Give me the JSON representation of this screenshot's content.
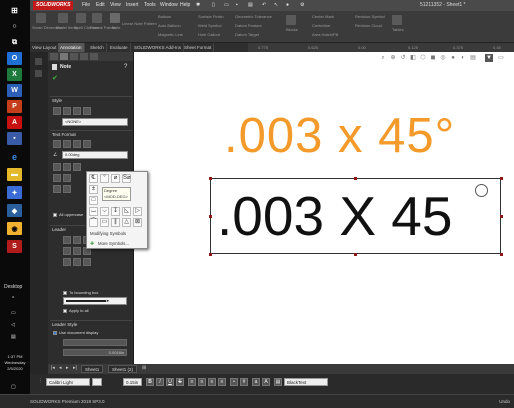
{
  "taskbar": {
    "desktop_label": "Desktop",
    "time": "1:37 PM",
    "day": "Wednesday",
    "date": "2/5/2020"
  },
  "app": {
    "logo": "SOLIDWORKS",
    "menu": [
      "File",
      "Edit",
      "View",
      "Insert",
      "Tools",
      "Window",
      "Help"
    ],
    "doc_name": "51211352 - Sheet1 *",
    "status": "SOLIDWORKS Premium 2019 SP3.0",
    "units": "Undo"
  },
  "ribbon": {
    "smart_dimension": "Smart Dimension",
    "model_items": "Model Items",
    "spell_checker": "Spell Checker",
    "format_painter": "Format Painter",
    "note": "Note",
    "linear_note_pattern": "Linear Note Pattern",
    "balloon": "Balloon",
    "auto_balloon": "Auto Balloon",
    "magnetic_line": "Magnetic Line",
    "surface_finish": "Surface Finish",
    "weld_symbol": "Weld Symbol",
    "hole_callout": "Hole Callout",
    "geometric_tolerance": "Geometric Tolerance",
    "datum_feature": "Datum Feature",
    "datum_target": "Datum Target",
    "blocks": "Blocks",
    "center_mark": "Center Mark",
    "centerline": "Centerline",
    "area_hatch": "Area Hatch/Fill",
    "revision_symbol": "Revision Symbol",
    "revision_cloud": "Revision Cloud",
    "tables": "Tables"
  },
  "command_tabs": [
    "View Layout",
    "Annotation",
    "Sketch",
    "Evaluate",
    "SOLIDWORKS Add-Ins",
    "Sheet Format"
  ],
  "active_command_tab": "Annotation",
  "ruler": [
    "0.775",
    "0.625",
    "0.00",
    "0.125",
    "0.375",
    "0.45"
  ],
  "panel": {
    "title": "Note",
    "style_label": "Style",
    "style_value": "<NONE>",
    "text_format_label": "Text Format",
    "angle_value": "0.00deg",
    "all_uppercase": "All uppercase",
    "leader_label": "Leader",
    "bounding_box": "To bounding box",
    "apply_to_all": "Apply to all",
    "leader_style_label": "Leader Style",
    "use_document_display": "Use document display",
    "thickness_value": "0.0018in"
  },
  "popup": {
    "tooltip_title": "Degree",
    "tooltip_code": "<MOD-DEG>",
    "modifying_symbols": "Modifying Symbols",
    "more_symbols": "More Symbols..."
  },
  "canvas": {
    "preview_text": ".003 x 45°",
    "note_text": ".003 X 45",
    "preview_color": "#f39a2a"
  },
  "sheets": [
    "Sheet1",
    "Sheet1 (2)"
  ],
  "format_bar": {
    "font": "Calibri Light",
    "size": "0.15in",
    "layer": "BlackText"
  }
}
